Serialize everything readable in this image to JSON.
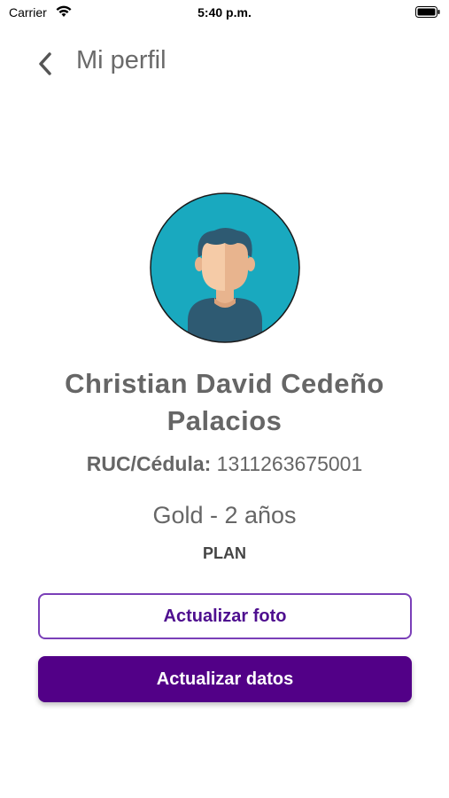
{
  "status_bar": {
    "carrier": "Carrier",
    "time": "5:40 p.m."
  },
  "header": {
    "title": "Mi perfil"
  },
  "profile": {
    "name": "Christian David Cedeño Palacios",
    "id_label": "RUC/Cédula:",
    "id_value": "1311263675001",
    "plan_name": "Gold - 2 años",
    "plan_label": "PLAN"
  },
  "actions": {
    "update_photo": "Actualizar foto",
    "update_data": "Actualizar datos"
  },
  "colors": {
    "primary": "#520087",
    "avatar_bg": "#19A9BF"
  }
}
